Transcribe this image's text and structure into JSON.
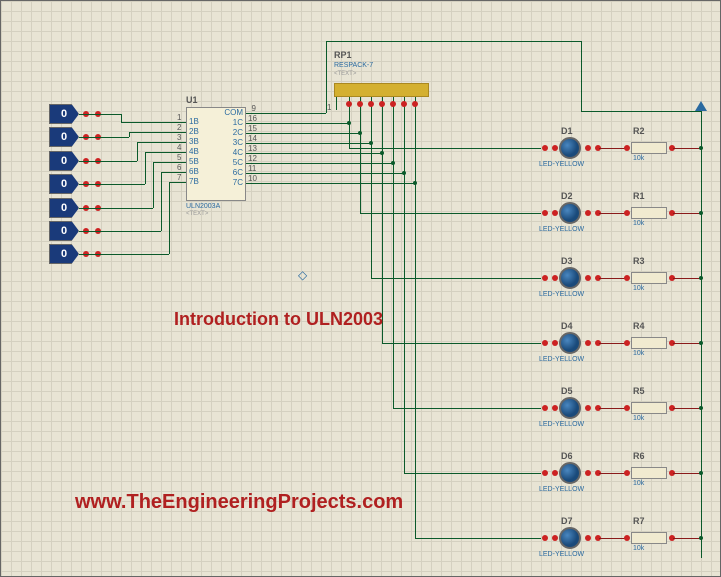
{
  "ic": {
    "ref": "U1",
    "part": "ULN2003A",
    "sub": "<TEXT>",
    "left_pins": [
      {
        "n": "1",
        "l": "1B"
      },
      {
        "n": "2",
        "l": "2B"
      },
      {
        "n": "3",
        "l": "3B"
      },
      {
        "n": "4",
        "l": "4B"
      },
      {
        "n": "5",
        "l": "5B"
      },
      {
        "n": "6",
        "l": "6B"
      },
      {
        "n": "7",
        "l": "7B"
      }
    ],
    "right_pins": [
      {
        "n": "9",
        "l": "COM"
      },
      {
        "n": "16",
        "l": "1C"
      },
      {
        "n": "15",
        "l": "2C"
      },
      {
        "n": "14",
        "l": "3C"
      },
      {
        "n": "13",
        "l": "4C"
      },
      {
        "n": "12",
        "l": "5C"
      },
      {
        "n": "11",
        "l": "6C"
      },
      {
        "n": "10",
        "l": "7C"
      }
    ]
  },
  "respack": {
    "ref": "RP1",
    "part": "RESPACK-7",
    "sub": "<TEXT>",
    "pin1": "1"
  },
  "logic_inputs": [
    "0",
    "0",
    "0",
    "0",
    "0",
    "0",
    "0"
  ],
  "outputs": [
    {
      "led_ref": "D1",
      "led_part": "LED-YELLOW",
      "res_ref": "R2",
      "res_val": "10k"
    },
    {
      "led_ref": "D2",
      "led_part": "LED-YELLOW",
      "res_ref": "R1",
      "res_val": "10k"
    },
    {
      "led_ref": "D3",
      "led_part": "LED-YELLOW",
      "res_ref": "R3",
      "res_val": "10k"
    },
    {
      "led_ref": "D4",
      "led_part": "LED-YELLOW",
      "res_ref": "R4",
      "res_val": "10k"
    },
    {
      "led_ref": "D5",
      "led_part": "LED-YELLOW",
      "res_ref": "R5",
      "res_val": "10k"
    },
    {
      "led_ref": "D6",
      "led_part": "LED-YELLOW",
      "res_ref": "R6",
      "res_val": "10k"
    },
    {
      "led_ref": "D7",
      "led_part": "LED-YELLOW",
      "res_ref": "R7",
      "res_val": "10k"
    }
  ],
  "sub": "<TEXT>",
  "title_text": "Introduction to ULN2003",
  "website": "www.TheEngineeringProjects.com"
}
